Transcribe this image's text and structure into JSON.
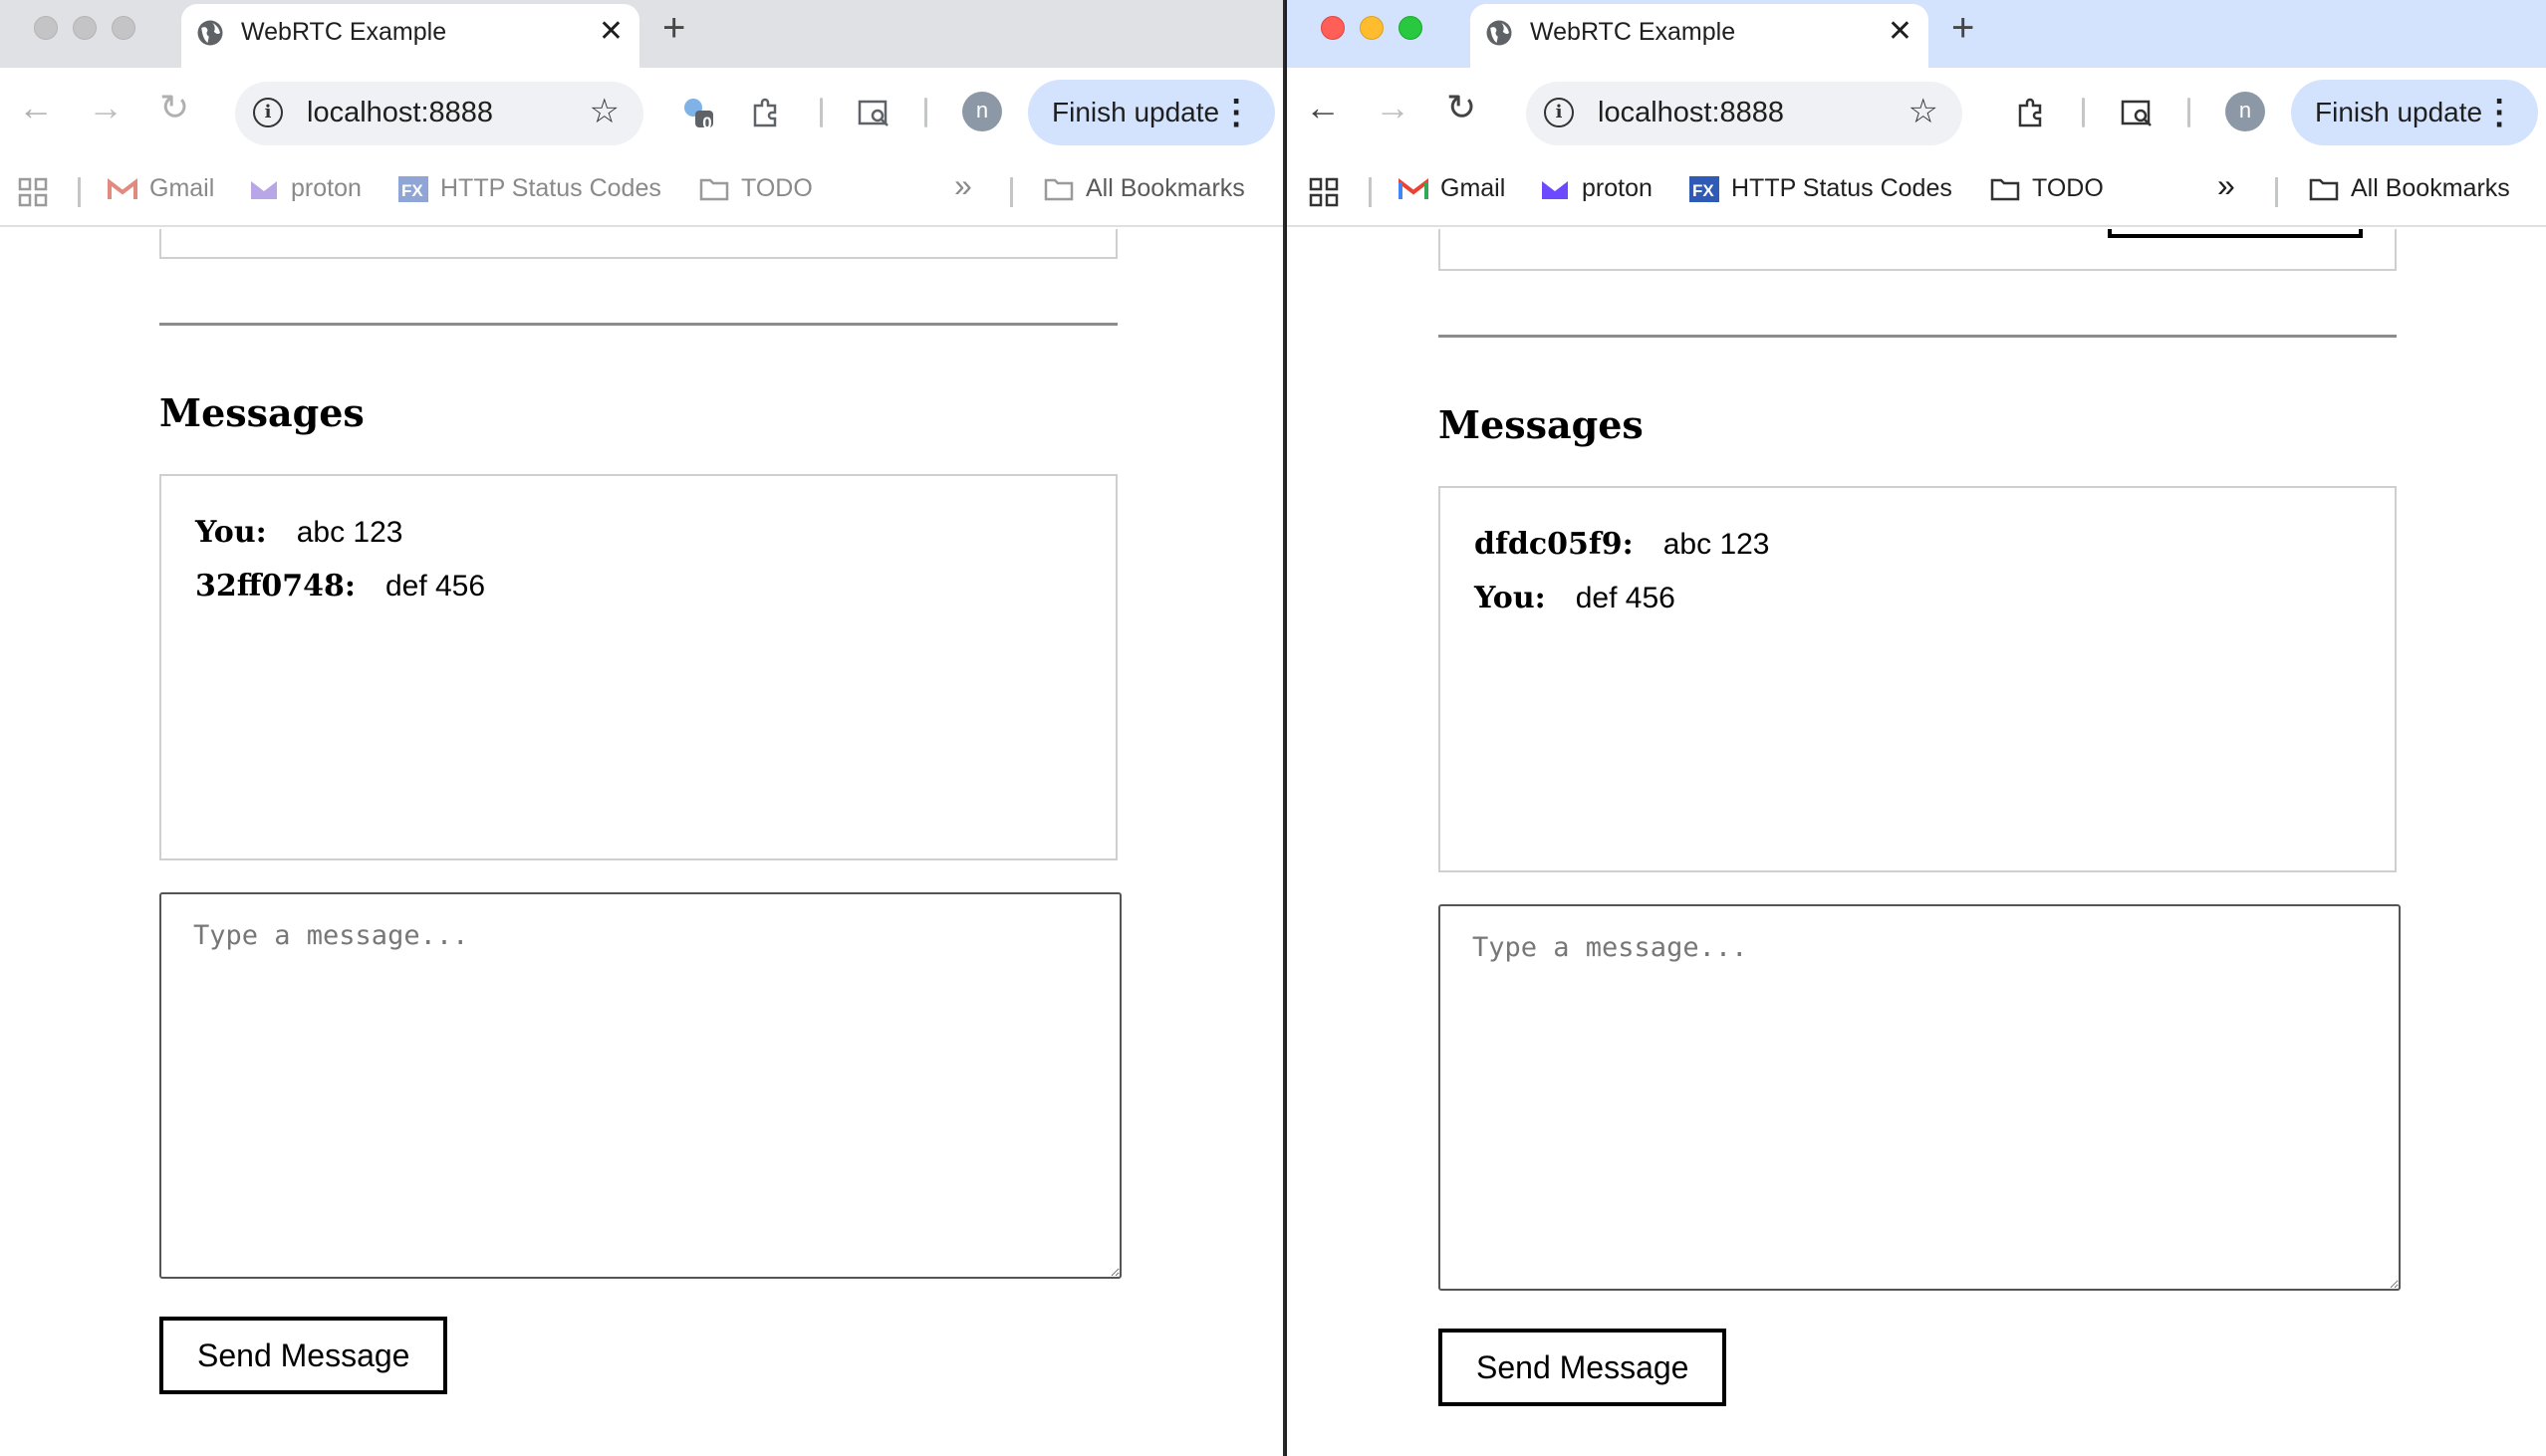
{
  "windows": [
    {
      "tab_title": "WebRTC Example",
      "url": "localhost:8888",
      "extension_badge": "0",
      "profile_initial": "n",
      "finish_update_label": "Finish update",
      "bookmarks": [
        "Gmail",
        "proton",
        "HTTP Status Codes",
        "TODO"
      ],
      "all_bookmarks": "All Bookmarks",
      "overflow": "»",
      "messages_heading": "Messages",
      "messages": [
        {
          "sender": "You:",
          "text": "abc 123"
        },
        {
          "sender": "32ff0748:",
          "text": "def 456"
        }
      ],
      "compose_placeholder": "Type a message...",
      "send_label": "Send Message"
    },
    {
      "tab_title": "WebRTC Example",
      "url": "localhost:8888",
      "profile_initial": "n",
      "finish_update_label": "Finish update",
      "bookmarks": [
        "Gmail",
        "proton",
        "HTTP Status Codes",
        "TODO"
      ],
      "all_bookmarks": "All Bookmarks",
      "overflow": "»",
      "messages_heading": "Messages",
      "messages": [
        {
          "sender": "dfdc05f9:",
          "text": "abc 123"
        },
        {
          "sender": "You:",
          "text": "def 456"
        }
      ],
      "compose_placeholder": "Type a message...",
      "send_label": "Send Message"
    }
  ],
  "icons": {
    "tab_favicon": "globe-icon",
    "tab_close": "close-icon",
    "new_tab": "plus-icon",
    "nav_back": "arrow-left-icon",
    "nav_forward": "arrow-right-icon",
    "reload": "reload-icon",
    "site_info": "info-icon",
    "bookmark_star": "star-icon",
    "extension": "puzzle-icon",
    "tab_search": "tab-search-icon",
    "menu": "kebab-menu-icon",
    "apps": "apps-grid-icon",
    "folder": "folder-icon"
  },
  "colors": {
    "inactive_tabstrip": "#dfe1e5",
    "active_tabstrip": "#d3e3fd",
    "finish_update_bg": "#d3e3fd",
    "traffic_red": "#ff5f57",
    "traffic_yellow": "#febc2e",
    "traffic_green": "#28c840"
  }
}
